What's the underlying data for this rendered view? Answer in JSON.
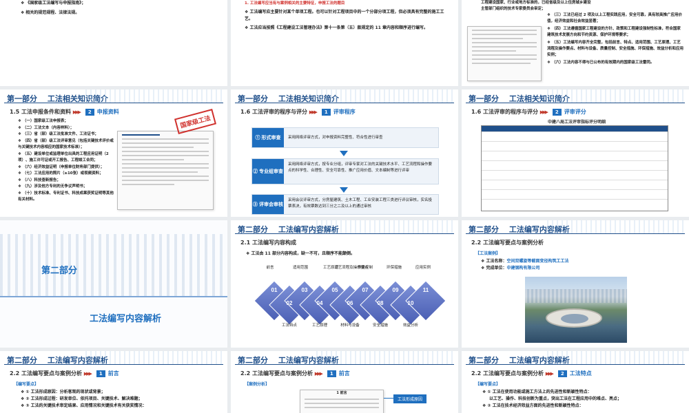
{
  "row1": {
    "s1": {
      "items": [
        "《国家级工法编写与申报指南》；",
        "相关的规范规程、法律法规。"
      ]
    },
    "s2": {
      "items": [
        "1.  工法编写应当有与案例相关的主要特征，申报工法的题目",
        "工法编写应主要针对某个单项工程。也可以针对工程项目中的一个分部分项工程，但必须具有完整的施工工艺。",
        "工法应当按照《工程建设工法管理办法》第十一条第（五）款规定的 11 章内容和顺序进行编写。"
      ]
    },
    "s3": {
      "items": [
        "工程建设国家、行业或地方标准的，已经省级及以上住房城乡建设主管部门组织的技术专家委员会审定；",
        "（三）工法已经过 2 项及以上工程实践应用，安全可靠，具有较高推广应用价值，经济效益和社会效益显著；",
        "（四）工法遵循国家工程建设的方针、政策和工程建设强制性标准，符合国家建筑技术发展方向和节约资源、保护环境等要求；",
        "（五）工法编写内容齐全完整，包括前言、特点、适用范围、工艺原理、工艺流程及操作要点、材料与设备、质量控制、安全措施、环保措施、效益分析和应用实例；",
        "（六）工法内容不得与已公布的有效期内的国家级工法雷同。"
      ]
    }
  },
  "row2": {
    "s1": {
      "part": "第一部分　 工法相关知识简介",
      "section": "1.5   工法申报条件和资料",
      "num": "2",
      "label": "申报资料",
      "stamp": "国家级工法",
      "items": [
        "（一）国家级工法申报表；",
        "（二）工法文本（内容样料）；",
        "（三）省（部）级工法批准文件、工法证书；",
        "（四）省（部）级工法评审意见（包括关键技术评价或与关键技术内容相应的国家技术标准）；",
        "（五）建设单位或监理单位出具的工程应用证明（2项）、施工许可证或开工报告、工程竣工合同；",
        "（六）经济效益证明（申报单位财务部门提供）；",
        "（七）工法应用的照片（≥10张）或视频资料；",
        "（八）科技查新报告；",
        "（九）涉及他方专利的无争议声明书；",
        "（十）技术标准、专利证书、科技成果获奖证明等其他有关材料。"
      ]
    },
    "s2": {
      "part": "第一部分　 工法相关知识简介",
      "section": "1.6   工法评审的程序与评分",
      "num": "1",
      "label": "评审程序",
      "steps": [
        {
          "head": "① 形式审查",
          "body": "采用网络评审方式，对申报资料完整性、符合性进行审查"
        },
        {
          "head": "② 专业组审查",
          "body": "采用网络评审方式，按专业分组，评审专家对工法的关键技术水平、工艺流程和操作要点的科学性、合理性、安全可靠性、推广应用价值、文本编制等进行评审"
        },
        {
          "head": "③ 评审会审核",
          "body": "采用会议评审方式，分房屋建筑、土木工程、工业安装工程三类进行评议审核，实名投票表决，有效票数达到三分之二及以上的通过审核"
        }
      ]
    },
    "s3": {
      "part": "第一部分　 工法相关知识简介",
      "section": "1.6   工法评审的程序与评分",
      "num": "2",
      "label": "评审评分",
      "table_title": "中建八局工法评审指标评分明细"
    }
  },
  "row3": {
    "s1": {
      "part": "第二部分",
      "title": "工法编写内容解析"
    },
    "s2": {
      "part": "第二部分　 工法编写内容解析",
      "section": "2.1   工法编写内容构成",
      "intro": "工法由 11 部分内容构成，缺一不可，且顺序不能颠倒。",
      "top_labels": [
        "前言",
        "适用范围",
        "工艺原理",
        "工艺流程及操作要点",
        "质量控制",
        "环保措施",
        "应用实例"
      ],
      "bottom_labels": [
        "工法特点",
        "工艺原理",
        "材料与设备",
        "安全措施",
        "效益分析"
      ],
      "top_nums": [
        "01",
        "03",
        "05",
        "07",
        "09",
        "11"
      ],
      "bottom_nums": [
        "02",
        "04",
        "06",
        "08",
        "10"
      ]
    },
    "s3": {
      "part": "第二部分　 工法编写内容解析",
      "section": "2.2   工法编写要点与案例分析",
      "case_head": "【工法案例】",
      "case_name_label": "工法名称：",
      "case_name": "空间双螺旋等截面变径构筑工工法",
      "case_unit_label": "完成单位：",
      "case_unit": "中建钢构有限公司"
    }
  },
  "row4": {
    "s1": {
      "part": "第二部分　 工法编写内容解析",
      "section": "2.2   工法编写要点与案例分析",
      "num": "1",
      "label": "前言",
      "head": "【编写要点】",
      "items": [
        "①  工法形成原因：分析客观的现状或背景；",
        "②  工法形成过程：研发单位、依托项目、关键技术、解决难题；",
        "③  工法的关键技术审定结果、应用情况和关键技术有关获奖情况："
      ]
    },
    "s2": {
      "part": "第二部分　 工法编写内容解析",
      "section": "2.2   工法编写要点与案例分析",
      "num": "1",
      "label": "前言",
      "head": "【案例分析】",
      "doc_title": "1 前言",
      "tag": "工法形成原因"
    },
    "s3": {
      "part": "第二部分　 工法编写内容解析",
      "section": "2.2   工法编写要点与案例分析",
      "num": "2",
      "label": "工法特点",
      "head": "【编写要点】",
      "items": [
        "①  工法在使用功能或施工方法上的先进性和新颖性特点：",
        "以工艺、操作、科技创新为重点，突出工法在工程应用中的难点、亮点；",
        "②  工法在技术经济效益方面的先进性和新颖性特点："
      ]
    }
  }
}
